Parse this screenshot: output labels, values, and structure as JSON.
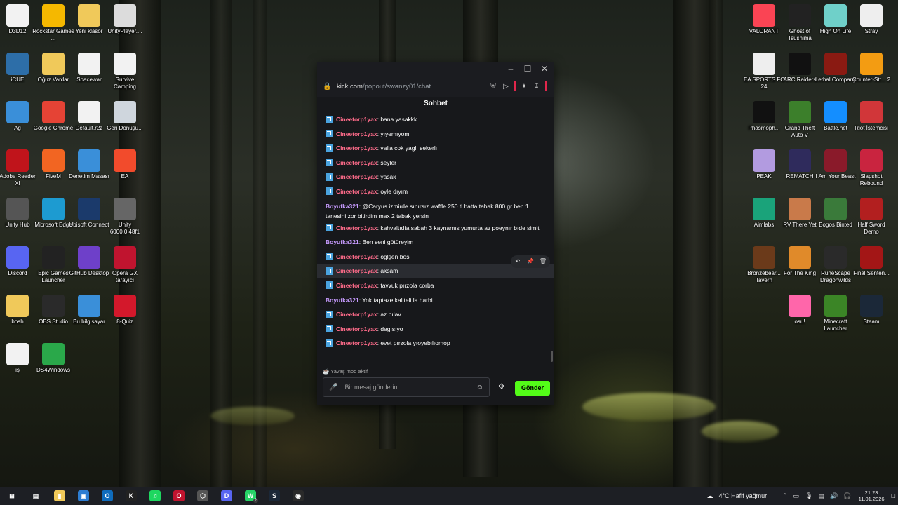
{
  "desktop_left": [
    {
      "label": "D3D12",
      "icon": "file-icon",
      "color": "#f2f2f2"
    },
    {
      "label": "Rockstar Games ...",
      "icon": "rockstar-icon",
      "color": "#f5b800"
    },
    {
      "label": "Yeni klasör",
      "icon": "folder-icon",
      "color": "#f0c95a"
    },
    {
      "label": "UnityPlayer....",
      "icon": "dll-icon",
      "color": "#dcdcdc"
    },
    {
      "label": "iCUE",
      "icon": "icue-icon",
      "color": "#2d6ea8"
    },
    {
      "label": "Oğuz Vardar",
      "icon": "user-folder-icon",
      "color": "#f0c95a"
    },
    {
      "label": "Spacewar",
      "icon": "file-icon",
      "color": "#f2f2f2"
    },
    {
      "label": "Survive Camping",
      "icon": "file-icon",
      "color": "#f2f2f2"
    },
    {
      "label": "Ağ",
      "icon": "network-icon",
      "color": "#3a8fd9"
    },
    {
      "label": "Google Chrome",
      "icon": "chrome-icon",
      "color": "#e54335"
    },
    {
      "label": "Default.r2z",
      "icon": "file-icon",
      "color": "#f2f2f2"
    },
    {
      "label": "Geri Dönüşü...",
      "icon": "recycle-bin-icon",
      "color": "#cfd6dd"
    },
    {
      "label": "Adobe Reader XI",
      "icon": "adobe-icon",
      "color": "#c0141b"
    },
    {
      "label": "FiveM",
      "icon": "fivem-icon",
      "color": "#f26522"
    },
    {
      "label": "Denetim Masası",
      "icon": "control-panel-icon",
      "color": "#3a8fd9"
    },
    {
      "label": "EA",
      "icon": "ea-icon",
      "color": "#f24b2c"
    },
    {
      "label": "Unity Hub",
      "icon": "unity-icon",
      "color": "#555"
    },
    {
      "label": "Microsoft Edge",
      "icon": "edge-icon",
      "color": "#1d9bd1"
    },
    {
      "label": "Ubisoft Connect",
      "icon": "ubisoft-icon",
      "color": "#1b3a6b"
    },
    {
      "label": "Unity 6000.0.48f1",
      "icon": "unity-icon",
      "color": "#666"
    },
    {
      "label": "Discord",
      "icon": "discord-icon",
      "color": "#5865f2"
    },
    {
      "label": "Epic Games Launcher",
      "icon": "epic-icon",
      "color": "#222"
    },
    {
      "label": "GitHub Desktop",
      "icon": "github-icon",
      "color": "#6e40c9"
    },
    {
      "label": "Opera GX tarayıcı",
      "icon": "opera-gx-icon",
      "color": "#c0142f"
    },
    {
      "label": "bosh",
      "icon": "folder-icon",
      "color": "#f0c95a"
    },
    {
      "label": "OBS Studio",
      "icon": "obs-icon",
      "color": "#2a2a2a"
    },
    {
      "label": "Bu bilgisayar",
      "icon": "computer-icon",
      "color": "#3a8fd9"
    },
    {
      "label": "8-Quiz",
      "icon": "opera-icon",
      "color": "#d3182b"
    },
    {
      "label": "iş",
      "icon": "file-icon",
      "color": "#f2f2f2"
    },
    {
      "label": "DS4Windows",
      "icon": "ds4-icon",
      "color": "#2aa84a"
    }
  ],
  "desktop_right": [
    {
      "label": "VALORANT",
      "icon": "valorant-icon",
      "color": "#fa4454"
    },
    {
      "label": "Ghost of Tsushima",
      "icon": "ghost-icon",
      "color": "#222"
    },
    {
      "label": "High On Life",
      "icon": "highonlife-icon",
      "color": "#6fd0c9"
    },
    {
      "label": "Stray",
      "icon": "stray-icon",
      "color": "#eee"
    },
    {
      "label": "EA SPORTS FC 24",
      "icon": "fc24-icon",
      "color": "#eee"
    },
    {
      "label": "ARC Raiders",
      "icon": "arc-raiders-icon",
      "color": "#111"
    },
    {
      "label": "Lethal Company",
      "icon": "lethal-company-icon",
      "color": "#8a1a12"
    },
    {
      "label": "Counter-Str... 2",
      "icon": "cs2-icon",
      "color": "#f39c12"
    },
    {
      "label": "Phasmoph...",
      "icon": "phasmophobia-icon",
      "color": "#111"
    },
    {
      "label": "Grand Theft Auto V",
      "icon": "gta-icon",
      "color": "#3c7f2b"
    },
    {
      "label": "Battle.net",
      "icon": "battlenet-icon",
      "color": "#148eff"
    },
    {
      "label": "Riot İstemcisi",
      "icon": "riot-icon",
      "color": "#d13639"
    },
    {
      "label": "PEAK",
      "icon": "peak-icon",
      "color": "#b29be0"
    },
    {
      "label": "REMATCH",
      "icon": "rematch-icon",
      "color": "#2f2b5c"
    },
    {
      "label": "I Am Your Beast",
      "icon": "beast-icon",
      "color": "#8a1a2a"
    },
    {
      "label": "Slapshot Rebound",
      "icon": "slapshot-icon",
      "color": "#c9243f"
    },
    {
      "label": "Aimlabs",
      "icon": "aimlabs-icon",
      "color": "#1aa37a"
    },
    {
      "label": "RV There Yet",
      "icon": "rv-icon",
      "color": "#c97a4a"
    },
    {
      "label": "Bogos Binted",
      "icon": "bogos-icon",
      "color": "#3a7a3a"
    },
    {
      "label": "Half Sword Demo",
      "icon": "halfsword-icon",
      "color": "#b21f1f"
    },
    {
      "label": "Bronzebear... Tavern",
      "icon": "tavern-icon",
      "color": "#6b3a1a"
    },
    {
      "label": "For The King",
      "icon": "fortheking-icon",
      "color": "#e08a2a"
    },
    {
      "label": "RuneScape Dragonwilds",
      "icon": "runescape-icon",
      "color": "#2a2a2a"
    },
    {
      "label": "Final Senten...",
      "icon": "final-sentence-icon",
      "color": "#a31616"
    },
    {
      "label": "",
      "icon": "blank",
      "color": "transparent"
    },
    {
      "label": "osu!",
      "icon": "osu-icon",
      "color": "#ff66aa"
    },
    {
      "label": "Minecraft Launcher",
      "icon": "minecraft-icon",
      "color": "#3b8526"
    },
    {
      "label": "Steam",
      "icon": "steam-icon",
      "color": "#1b2838"
    }
  ],
  "chat_window": {
    "url_domain": "kick.com",
    "url_path": "/popout/swanzy01/chat",
    "title": "Sohbet",
    "messages": [
      {
        "user": "Cineetorp1yax",
        "type": "c",
        "badge": true,
        "text": "bana yasakkk"
      },
      {
        "user": "Cineetorp1yax",
        "type": "c",
        "badge": true,
        "text": "yıyemıyom"
      },
      {
        "user": "Cineetorp1yax",
        "type": "c",
        "badge": true,
        "text": "valla cok yaglı sekerlı"
      },
      {
        "user": "Cineetorp1yax",
        "type": "c",
        "badge": true,
        "text": "seyler"
      },
      {
        "user": "Cineetorp1yax",
        "type": "c",
        "badge": true,
        "text": "yasak"
      },
      {
        "user": "Cineetorp1yax",
        "type": "c",
        "badge": true,
        "text": "oyle dıyım"
      },
      {
        "user": "Boyufka321",
        "type": "b",
        "badge": false,
        "text": "@Caryus izmirde sınırsız waffle 250 tl hatta tabak 800 gr ben 1 tanesini zor bitirdim max 2 tabak yersin"
      },
      {
        "user": "Cineetorp1yax",
        "type": "c",
        "badge": true,
        "text": "kahvaltıdfa sabah 3 kaynamıs yumurta az poeynır bıde simit"
      },
      {
        "user": "Boyufka321",
        "type": "b",
        "badge": false,
        "text": "Ben seni götüreyim"
      },
      {
        "user": "Cineetorp1yax",
        "type": "c",
        "badge": true,
        "text": "oglşen bos"
      },
      {
        "user": "Cineetorp1yax",
        "type": "c",
        "badge": true,
        "text": "aksam",
        "highlight": true
      },
      {
        "user": "Cineetorp1yax",
        "type": "c",
        "badge": true,
        "text": "tavvuk pırzola corba"
      },
      {
        "user": "Boyufka321",
        "type": "b",
        "badge": false,
        "text": "Yok taptaze kaliteli la harbi"
      },
      {
        "user": "Cineetorp1yax",
        "type": "c",
        "badge": true,
        "text": "az pılav"
      },
      {
        "user": "Cineetorp1yax",
        "type": "c",
        "badge": true,
        "text": "degısıyo"
      },
      {
        "user": "Cineetorp1yax",
        "type": "c",
        "badge": true,
        "text": "evet pırzola yıoyebılıomop"
      }
    ],
    "slow_mode": "Yavaş mod aktif",
    "input_placeholder": "Bir mesaj gönderin",
    "send_label": "Gönder"
  },
  "taskbar": {
    "weather": "4°C  Hafif yağmur",
    "time": "21:23",
    "date": "11.01.2026",
    "apps": [
      "start-icon",
      "task-view-icon",
      "file-explorer-icon",
      "store-icon",
      "outlook-icon",
      "kick-app-icon",
      "spotify-icon",
      "opera-gx-icon",
      "unity-icon",
      "discord-icon",
      "whatsapp-icon",
      "steam-icon",
      "obs-icon"
    ],
    "whatsapp_badge": "2"
  }
}
